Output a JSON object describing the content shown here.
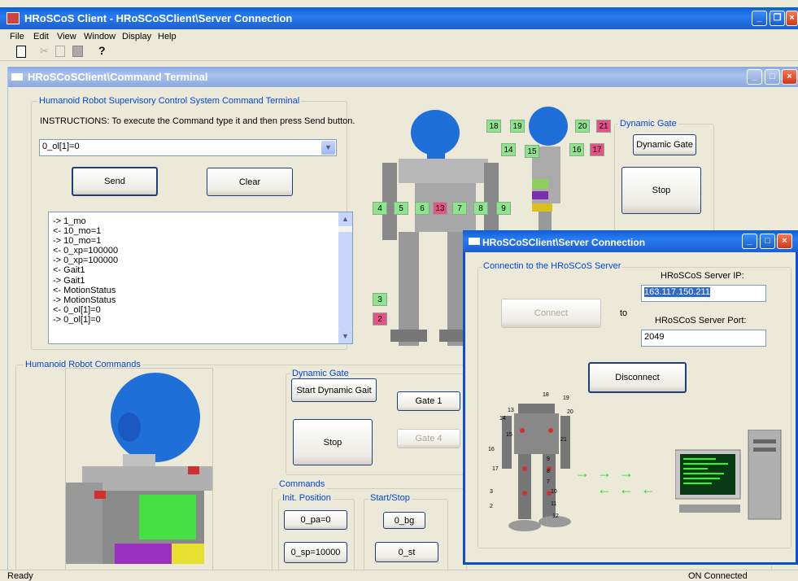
{
  "app": {
    "title": "HRoSCoS Client - HRoSCoSClient\\Server Connection",
    "menu": [
      "File",
      "Edit",
      "View",
      "Window",
      "Display",
      "Help"
    ],
    "status_left": "Ready",
    "status_right": "ON Connected"
  },
  "terminal": {
    "title": "HRoSCoSClient\\Command Terminal",
    "group_title": "Humanoid Robot Supervisory Control System Command Terminal",
    "instructions": "INSTRUCTIONS: To execute the Command type it and then press Send button.",
    "command_value": "0_ol[1]=0",
    "send_label": "Send",
    "clear_label": "Clear",
    "log": [
      "-> 1_mo",
      "<- 10_mo=1",
      "-> 10_mo=1",
      "<- 0_xp=100000",
      "-> 0_xp=100000",
      "<- Gait1",
      "-> Gait1",
      "<- MotionStatus",
      "-> MotionStatus",
      "<- 0_ol[1]=0",
      "-> 0_ol[1]=0"
    ]
  },
  "robot_labels": {
    "front": [
      "4",
      "5",
      "6",
      "13",
      "7",
      "8",
      "9",
      "3",
      "2"
    ],
    "side": [
      "18",
      "19",
      "20",
      "21",
      "14",
      "15",
      "16",
      "17"
    ]
  },
  "dynamic_gate_top": {
    "title": "Dynamic Gate",
    "gate_label": "Dynamic Gate",
    "stop_label": "Stop"
  },
  "commands_panel": {
    "title": "Humanoid Robot Commands",
    "dynamic_gate": {
      "title": "Dynamic Gate",
      "start_label": "Start Dynamic Gait",
      "gate1_label": "Gate 1",
      "stop_label": "Stop",
      "gate4_label": "Gate 4"
    },
    "commands": {
      "title": "Commands",
      "init_title": "Init. Position",
      "pa_label": "0_pa=0",
      "sp_label": "0_sp=10000",
      "startstop_title": "Start/Stop",
      "bg_label": "0_bg",
      "st_label": "0_st"
    }
  },
  "server": {
    "title": "HRoSCoSClient\\Server Connection",
    "group_title": "Connectin to the HRoSCoS Server",
    "ip_label": "HRoSCoS Server IP:",
    "ip_value": "163.117.150.211",
    "port_label": "HRoSCoS Server Port:",
    "port_value": "2049",
    "connect_label": "Connect",
    "to_label": "to",
    "disconnect_label": "Disconnect",
    "robot_joint_labels": [
      "18",
      "19",
      "13",
      "14",
      "20",
      "15",
      "21",
      "16",
      "17",
      "9",
      "8",
      "7",
      "3",
      "2",
      "10",
      "11",
      "12"
    ]
  },
  "colors": {
    "accent": "#0046d5",
    "title_active": "#0a5fd8",
    "label_green": "#8ee38e",
    "label_pink": "#e8508a",
    "arrow_green": "#22dd22"
  }
}
